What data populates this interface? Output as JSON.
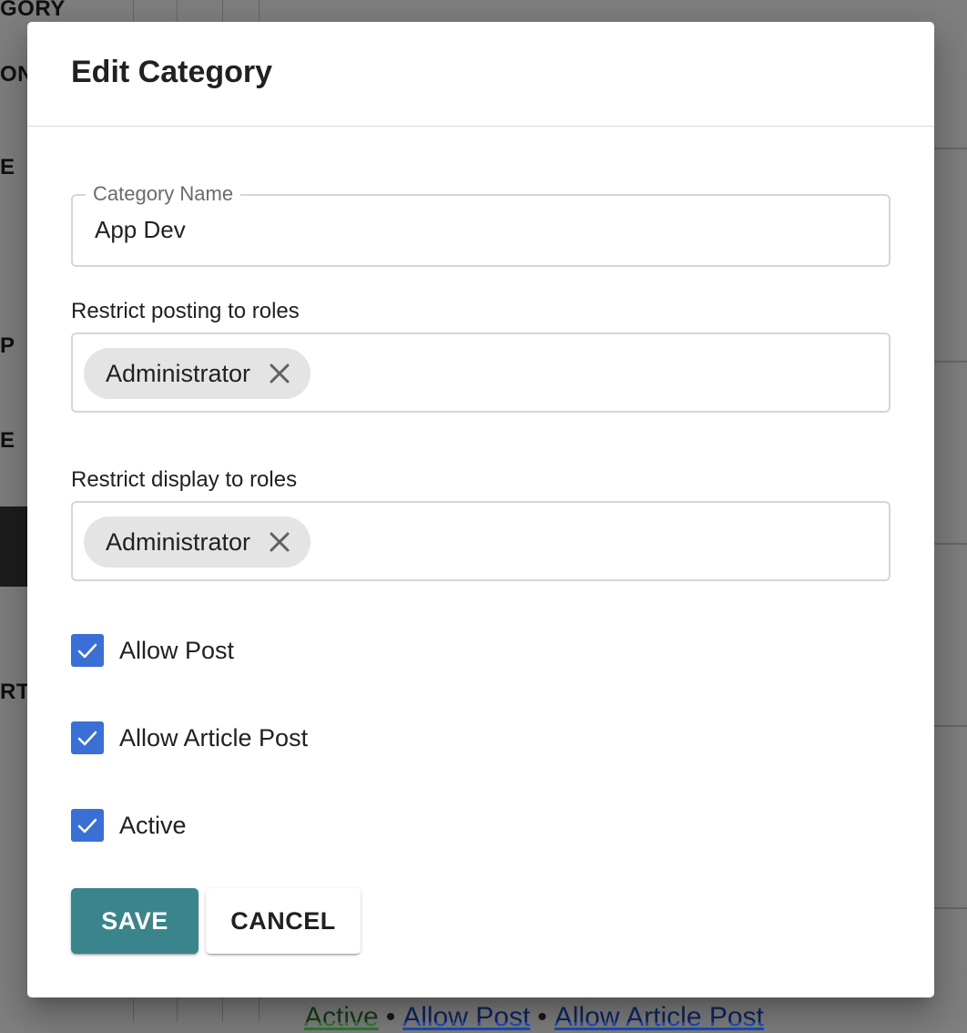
{
  "background": {
    "sidebar_fragments": [
      "GORY",
      "ON",
      "E",
      "P",
      "E",
      "RT"
    ],
    "footer": {
      "status": "Active",
      "separator": "•",
      "links": [
        "Allow Post",
        "Allow Article Post"
      ]
    },
    "colors": {
      "status_green": "#2e7d32",
      "link_blue": "#1a4fc2"
    }
  },
  "dialog": {
    "title": "Edit Category",
    "category_name": {
      "label": "Category Name",
      "value": "App Dev"
    },
    "posting_roles": {
      "label": "Restrict posting to roles",
      "chips": [
        {
          "label": "Administrator",
          "icon": "close-icon"
        }
      ]
    },
    "display_roles": {
      "label": "Restrict display to roles",
      "chips": [
        {
          "label": "Administrator",
          "icon": "close-icon"
        }
      ]
    },
    "checkboxes": [
      {
        "label": "Allow Post",
        "checked": true
      },
      {
        "label": "Allow Article Post",
        "checked": true
      },
      {
        "label": "Active",
        "checked": true
      }
    ],
    "buttons": {
      "save": "SAVE",
      "cancel": "CANCEL"
    },
    "colors": {
      "checkbox": "#3a6fd6",
      "save_button": "#3a848c"
    }
  }
}
